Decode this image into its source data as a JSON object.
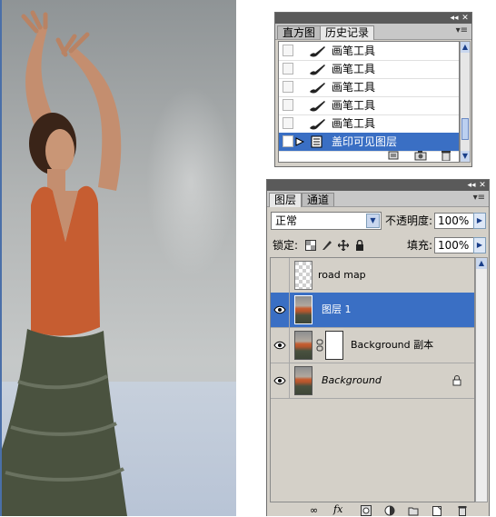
{
  "history_panel": {
    "tabs": [
      "直方图",
      "历史记录"
    ],
    "active_tab": 1,
    "items": [
      {
        "label": "画笔工具",
        "icon": "brush-icon",
        "selected": false
      },
      {
        "label": "画笔工具",
        "icon": "brush-icon",
        "selected": false
      },
      {
        "label": "画笔工具",
        "icon": "brush-icon",
        "selected": false
      },
      {
        "label": "画笔工具",
        "icon": "brush-icon",
        "selected": false
      },
      {
        "label": "画笔工具",
        "icon": "brush-icon",
        "selected": false
      },
      {
        "label": "盖印可见图层",
        "icon": "layer-stamp-icon",
        "selected": true
      }
    ],
    "footer_icons": [
      "new-document-from-state-icon",
      "snapshot-camera-icon",
      "trash-icon"
    ]
  },
  "layers_panel": {
    "tabs": [
      "图层",
      "通道"
    ],
    "active_tab": 0,
    "blend_mode": "正常",
    "opacity_label": "不透明度:",
    "opacity_value": "100%",
    "lock_label": "锁定:",
    "fill_label": "填充:",
    "fill_value": "100%",
    "layers": [
      {
        "name": "road map",
        "visible": false,
        "selected": false,
        "thumbnail": "transparent",
        "has_mask": false,
        "italic": false,
        "locked": false
      },
      {
        "name": "图层 1",
        "visible": true,
        "selected": true,
        "thumbnail": "photo",
        "has_mask": false,
        "italic": false,
        "locked": false
      },
      {
        "name": "Background 副本",
        "visible": true,
        "selected": false,
        "thumbnail": "photo",
        "has_mask": true,
        "italic": false,
        "locked": false
      },
      {
        "name": "Background",
        "visible": true,
        "selected": false,
        "thumbnail": "photo",
        "has_mask": false,
        "italic": true,
        "locked": true
      }
    ],
    "footer_icons": [
      "link-layers-icon",
      "fx-icon",
      "add-mask-icon",
      "adjustment-layer-icon",
      "new-group-icon",
      "new-layer-icon",
      "trash-icon"
    ]
  },
  "colors": {
    "selection": "#3a6fc4",
    "panel_bg": "#d4d0c8",
    "titlebar": "#5a5a5a",
    "top_color": "#c65d31",
    "skirt_color": "#4a523f"
  }
}
